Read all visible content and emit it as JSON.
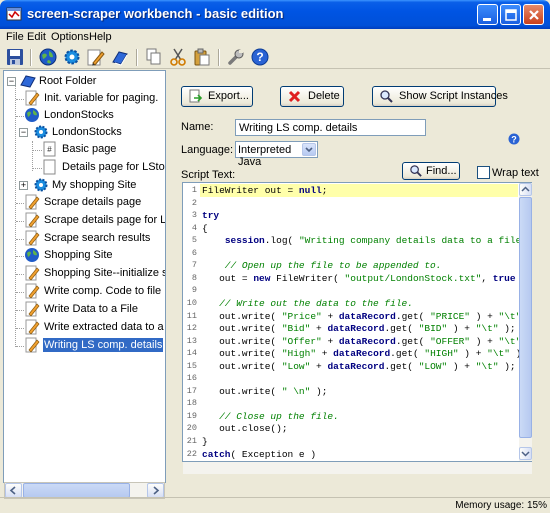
{
  "window": {
    "title": "screen-scraper workbench - basic edition"
  },
  "menu": [
    "File",
    "Edit",
    "Options",
    "Help"
  ],
  "toolbar": [
    "save-icon",
    "globe-icon",
    "gear-icon",
    "pencil-edit-icon",
    "book-icon",
    "copy-icon",
    "cut-icon",
    "paste-icon",
    "wrench-icon",
    "help-icon"
  ],
  "tree": {
    "root": "Root Folder",
    "items": [
      {
        "label": "Init. variable for paging.",
        "icon": "script-icon",
        "selected": false
      },
      {
        "label": "LondonStocks",
        "icon": "globe-icon",
        "selected": false
      },
      {
        "label": "LondonStocks",
        "icon": "gear-icon",
        "selected": false
      },
      {
        "label": "Basic page",
        "icon": "page-icon",
        "selected": false
      },
      {
        "label": "Details page for LStocks",
        "icon": "page-icon",
        "selected": false
      },
      {
        "label": "My shopping Site",
        "icon": "gear-icon",
        "selected": false
      },
      {
        "label": "Scrape details page",
        "icon": "script-icon",
        "selected": false
      },
      {
        "label": "Scrape details page for LStock",
        "icon": "script-icon",
        "selected": false
      },
      {
        "label": "Scrape search results",
        "icon": "script-icon",
        "selected": false
      },
      {
        "label": "Shopping Site",
        "icon": "globe-icon",
        "selected": false
      },
      {
        "label": "Shopping Site--initialize sessio",
        "icon": "script-icon",
        "selected": false
      },
      {
        "label": "Write comp. Code to file",
        "icon": "script-icon",
        "selected": false
      },
      {
        "label": "Write Data to a File",
        "icon": "script-icon",
        "selected": false
      },
      {
        "label": "Write extracted data to a file",
        "icon": "script-icon",
        "selected": false
      },
      {
        "label": "Writing LS comp. details",
        "icon": "script-icon",
        "selected": true
      }
    ]
  },
  "buttons": {
    "export": "Export...",
    "delete": "Delete",
    "show_instances": "Show Script Instances"
  },
  "form": {
    "name_label": "Name:",
    "name_value": "Writing LS comp. details",
    "language_label": "Language:",
    "language_value": "Interpreted Java",
    "script_text_label": "Script Text:",
    "find_label": "Find...",
    "wrap_text_label": "Wrap text",
    "wrap_text_checked": false
  },
  "script": {
    "line_numbers": [
      "1",
      "2",
      "3",
      "4",
      "5",
      "6",
      "7",
      "8",
      "9",
      "10",
      "11",
      "12",
      "13",
      "14",
      "15",
      "16",
      "17",
      "18",
      "19",
      "20",
      "21",
      "22"
    ],
    "lines": [
      "FileWriter out = null;",
      "",
      "try",
      "{",
      "    session.log( \"Writing company details data to a file.\"",
      "",
      "    // Open up the file to be appended to.",
      "   out = new FileWriter( \"output/LondonStock.txt\", true );",
      "",
      "   // Write out the data to the file.",
      "   out.write( \"Price\" + dataRecord.get( \"PRICE\" ) + \"\\t\" )",
      "   out.write( \"Bid\" + dataRecord.get( \"BID\" ) + \"\\t\" );",
      "   out.write( \"Offer\" + dataRecord.get( \"OFFER\" ) + \"\\t\" )",
      "   out.write( \"High\" + dataRecord.get( \"HIGH\" ) + \"\\t\" );",
      "   out.write( \"Low\" + dataRecord.get( \"LOW\" ) + \"\\t\" );",
      "",
      "   out.write( \" \\n\" );",
      "",
      "   // Close up the file.",
      "   out.close();",
      "}",
      "catch( Exception e )"
    ]
  },
  "status": {
    "memory": "Memory usage: 15%"
  },
  "colors": {
    "title_bar": "#0054e3",
    "selection": "#316ac5",
    "current_line": "#ffffaa"
  }
}
